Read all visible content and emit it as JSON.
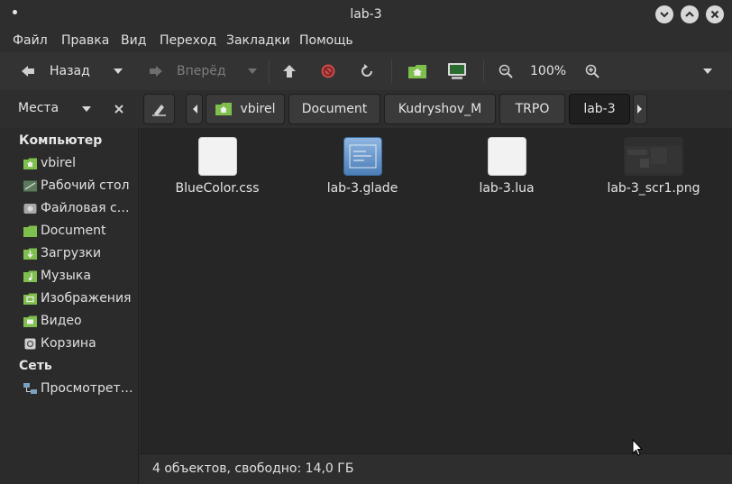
{
  "window": {
    "title": "lab-3"
  },
  "menu": [
    "Файл",
    "Правка",
    "Вид",
    "Переход",
    "Закладки",
    "Помощь"
  ],
  "toolbar": {
    "back_label": "Назад",
    "forward_label": "Вперёд",
    "zoom": "100%"
  },
  "places": {
    "label": "Места"
  },
  "breadcrumbs": [
    "vbirel",
    "Document",
    "Kudryshov_M",
    "TRPO",
    "lab-3"
  ],
  "sidebar": {
    "computer_header": "Компьютер",
    "items": [
      {
        "label": "vbirel",
        "icon": "home-folder-icon"
      },
      {
        "label": "Рабочий стол",
        "icon": "desktop-icon"
      },
      {
        "label": "Файловая си…",
        "icon": "drive-icon"
      },
      {
        "label": "Document",
        "icon": "folder-icon"
      },
      {
        "label": "Загрузки",
        "icon": "downloads-folder-icon"
      },
      {
        "label": "Музыка",
        "icon": "music-folder-icon"
      },
      {
        "label": "Изображения",
        "icon": "pictures-folder-icon"
      },
      {
        "label": "Видео",
        "icon": "videos-folder-icon"
      },
      {
        "label": "Корзина",
        "icon": "trash-icon"
      }
    ],
    "network_header": "Сеть",
    "network_items": [
      {
        "label": "Просмотреть …",
        "icon": "network-icon"
      }
    ]
  },
  "files": [
    {
      "name": "BlueColor.css",
      "icon": "text-file-icon"
    },
    {
      "name": "lab-3.glade",
      "icon": "glade-file-icon"
    },
    {
      "name": "lab-3.lua",
      "icon": "text-file-icon"
    },
    {
      "name": "lab-3_scr1.png",
      "icon": "image-thumbnail-icon"
    }
  ],
  "status": {
    "text": "4 объектов, свободно: 14,0 ГБ"
  },
  "colors": {
    "folder_green": "#7fbf4d",
    "active_crumb": "#1f1f1f"
  }
}
